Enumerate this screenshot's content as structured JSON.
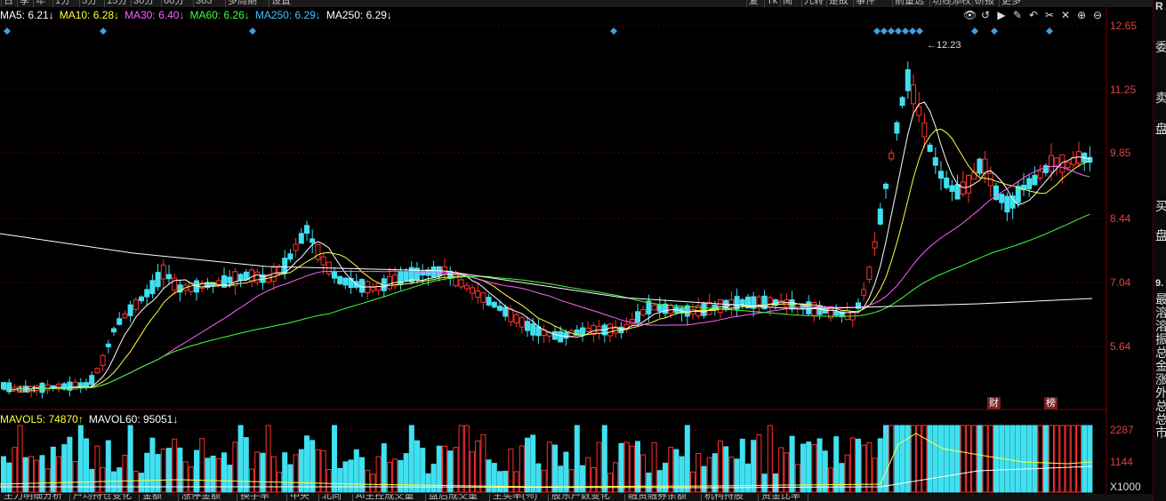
{
  "toolbar_top": {
    "left_items": [
      "日",
      "季",
      "年",
      "1分",
      "5分",
      "15分",
      "30分",
      "60分",
      "365",
      "多周期",
      "设置"
    ],
    "right_items": [
      "复",
      "Tk",
      "简",
      "九转",
      "是故",
      "事件",
      "前量选",
      "功线",
      "添权",
      "研报",
      "更多"
    ]
  },
  "ma_legend": [
    {
      "label": "MA5: 6.21",
      "arrow": "↓",
      "color": "#ffffff"
    },
    {
      "label": "MA10: 6.28",
      "arrow": "↓",
      "color": "#ffff40"
    },
    {
      "label": "MA30: 6.40",
      "arrow": "↓",
      "color": "#ff60ff"
    },
    {
      "label": "MA60: 6.26",
      "arrow": "↓",
      "color": "#40ff40"
    },
    {
      "label": "MA250: 6.29",
      "arrow": "↓",
      "color": "#40c0ff"
    },
    {
      "label": "MA250: 6.29",
      "arrow": "↓",
      "color": "#ffffff"
    }
  ],
  "vol_legend": [
    {
      "label": "MAVOL5: 74870",
      "arrow": "↑",
      "color": "#ffff40"
    },
    {
      "label": "MAVOL60: 95051",
      "arrow": "↓",
      "color": "#ffffff"
    }
  ],
  "price_axis": [
    "12.65",
    "11.25",
    "9.85",
    "8.44",
    "7.04",
    "5.64"
  ],
  "vol_axis": [
    "2287",
    "1144",
    "X1000"
  ],
  "annotations": {
    "high": "12.23",
    "low": "4.64"
  },
  "markers": {
    "cai": "财",
    "bang": "榜"
  },
  "side_panel": {
    "top": "R",
    "wei": "委",
    "mai": "卖",
    "pan": "盘",
    "mai2": "买",
    "pan2": "盘",
    "val": "9.",
    "rest": "最溶溶振总金涨外总总市"
  },
  "bottom_tabs": [
    "主力明细分析",
    "户均持仓变化",
    "金额",
    "涨停金额",
    "换手率",
    "中央",
    "北向",
    "AI主控成交量",
    "盘后成交量",
    "主买率(%)",
    "股东户数变化",
    "融资融券余额",
    "机构持股",
    "资金比率"
  ],
  "icons": [
    "eye-icon",
    "undo-icon",
    "play-icon",
    "pen-icon",
    "back-icon",
    "scissors-icon",
    "close-icon",
    "zoom-in-icon",
    "zoom-out-icon"
  ]
}
